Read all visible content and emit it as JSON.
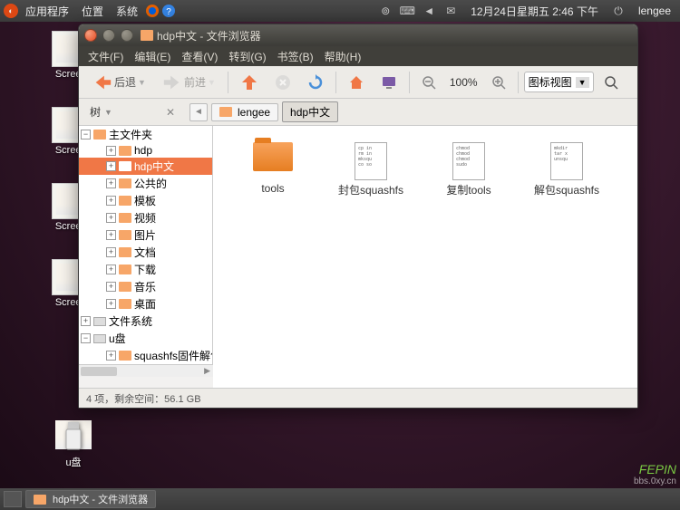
{
  "panel": {
    "apps": "应用程序",
    "places": "位置",
    "system": "系统",
    "datetime": "12月24日星期五 2:46 下午",
    "user": "lengee"
  },
  "desktop_icons": [
    {
      "label": "Screens"
    },
    {
      "label": "Screens"
    },
    {
      "label": "Screens"
    },
    {
      "label": "Screens"
    }
  ],
  "usb_label": "u盘",
  "window": {
    "title": "hdp中文 - 文件浏览器",
    "menus": {
      "file": "文件(F)",
      "edit": "编辑(E)",
      "view": "查看(V)",
      "go": "转到(G)",
      "bookmarks": "书签(B)",
      "help": "帮助(H)"
    },
    "toolbar": {
      "back": "后退",
      "forward": "前进",
      "zoom": "100%",
      "view_mode": "图标视图"
    },
    "sidepanel_mode": "树",
    "breadcrumb": [
      {
        "label": "lengee",
        "active": false,
        "icon": "folder"
      },
      {
        "label": "hdp中文",
        "active": true,
        "icon": "none"
      }
    ],
    "tree": [
      {
        "label": "主文件夹",
        "indent": 0,
        "expanded": true,
        "icon": "folder",
        "selected": false
      },
      {
        "label": "hdp",
        "indent": 1,
        "expanded": false,
        "icon": "folder",
        "selected": false
      },
      {
        "label": "hdp中文",
        "indent": 1,
        "expanded": false,
        "icon": "folder",
        "selected": true
      },
      {
        "label": "公共的",
        "indent": 1,
        "expanded": false,
        "icon": "folder",
        "selected": false
      },
      {
        "label": "模板",
        "indent": 1,
        "expanded": false,
        "icon": "folder",
        "selected": false
      },
      {
        "label": "视频",
        "indent": 1,
        "expanded": false,
        "icon": "folder",
        "selected": false
      },
      {
        "label": "图片",
        "indent": 1,
        "expanded": false,
        "icon": "folder",
        "selected": false
      },
      {
        "label": "文档",
        "indent": 1,
        "expanded": false,
        "icon": "folder",
        "selected": false
      },
      {
        "label": "下载",
        "indent": 1,
        "expanded": false,
        "icon": "folder",
        "selected": false
      },
      {
        "label": "音乐",
        "indent": 1,
        "expanded": false,
        "icon": "folder",
        "selected": false
      },
      {
        "label": "桌面",
        "indent": 1,
        "expanded": false,
        "icon": "folder",
        "selected": false
      },
      {
        "label": "文件系统",
        "indent": 0,
        "expanded": false,
        "icon": "drive",
        "selected": false
      },
      {
        "label": "u盘",
        "indent": 0,
        "expanded": true,
        "icon": "drive",
        "selected": false
      },
      {
        "label": "squashfs固件解包封包",
        "indent": 1,
        "expanded": false,
        "icon": "folder",
        "selected": false
      }
    ],
    "files": [
      {
        "name": "tools",
        "type": "folder"
      },
      {
        "name": "封包squashfs",
        "type": "script",
        "preview": "cp in\nrm in\nmksqu\nco so"
      },
      {
        "name": "复制tools",
        "type": "script",
        "preview": "chmod\nchmod\nchmod\nsudo"
      },
      {
        "name": "解包squashfs",
        "type": "script",
        "preview": "mkdir\ntar x\nunsqu"
      }
    ],
    "status": "4 项，剩余空间：56.1 GB"
  },
  "taskbar": {
    "app": "hdp中文 - 文件浏览器"
  },
  "watermark": {
    "brand": "FEPIN",
    "url": "bbs.0xy.cn"
  }
}
